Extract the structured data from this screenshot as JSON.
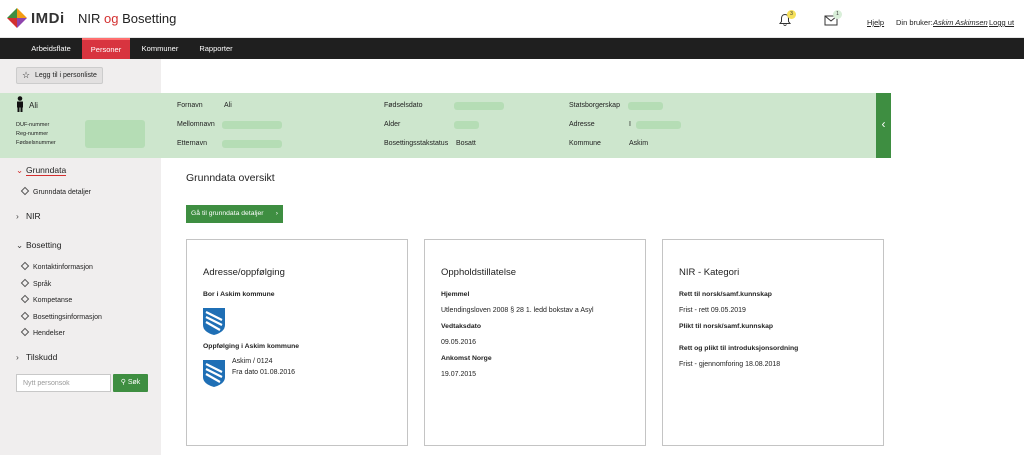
{
  "header": {
    "logo_text": "IMDi",
    "title_part1": "NIR",
    "title_og": "og",
    "title_part2": "Bosetting",
    "notifications_count": "3",
    "messages_count": "1",
    "help_label": "Hjelp",
    "user_prefix": "Din bruker:",
    "user_name": "Askim Askimsen",
    "logout_label": "Logg ut"
  },
  "nav": {
    "items": [
      {
        "label": "Arbeidsflate",
        "active": false
      },
      {
        "label": "Personer",
        "active": true
      },
      {
        "label": "Kommuner",
        "active": false
      },
      {
        "label": "Rapporter",
        "active": false
      }
    ]
  },
  "sidebar": {
    "personliste_button": "Legg til i personliste",
    "sections": [
      {
        "label": "Grunndata",
        "open": true,
        "items": [
          "Grunndata detaljer"
        ]
      },
      {
        "label": "NIR",
        "open": false,
        "items": []
      },
      {
        "label": "Bosetting",
        "open": true,
        "items": [
          "Kontaktinformasjon",
          "Språk",
          "Kompetanse",
          "Bosettingsinformasjon",
          "Hendelser"
        ]
      },
      {
        "label": "Tilskudd",
        "open": false,
        "items": []
      }
    ],
    "search_placeholder": "Nytt personsok",
    "search_button": "Søk"
  },
  "person": {
    "name": "Ali",
    "duf_label": "DUF-nummer",
    "reg_label": "Reg-nummer",
    "fodsel_label": "Fødselsnummer",
    "fornavn_label": "Fornavn",
    "fornavn_value": "Ali",
    "mellomnavn_label": "Mellomnavn",
    "etternavn_label": "Etternavn",
    "fodselsdato_label": "Fødselsdato",
    "alder_label": "Alder",
    "bosettingsstatus_label": "Bosettingsstakstatus",
    "bosettingsstatus_value": "Bosatt",
    "statsborgerskap_label": "Statsborgerskap",
    "adresse_label": "Adresse",
    "adresse_value": "I",
    "kommune_label": "Kommune",
    "kommune_value": "Askim"
  },
  "main": {
    "title": "Grunndata oversikt",
    "go_button": "Gå til grunndata detaljer",
    "go_arrow": "›",
    "cards": {
      "adresse": {
        "title": "Adresse/oppfølging",
        "bor_label": "Bor i Askim kommune",
        "oppfolging_label": "Oppfølging i Askim kommune",
        "kommune_nr": "Askim / 0124",
        "fra_dato": "Fra dato 01.08.2016"
      },
      "opphold": {
        "title": "Oppholdstillatelse",
        "hjemmel_label": "Hjemmel",
        "hjemmel_value": "Utlendingsloven 2008 § 28 1. ledd bokstav a Asyl",
        "vedtak_label": "Vedtaksdato",
        "vedtak_value": "09.05.2016",
        "ankomst_label": "Ankomst Norge",
        "ankomst_value": "19.07.2015"
      },
      "nir": {
        "title": "NIR - Kategori",
        "rett_label": "Rett til norsk/samf.kunnskap",
        "rett_value": "Frist - rett 09.05.2019",
        "plikt_label": "Plikt til norsk/samf.kunnskap",
        "intro_label": "Rett og plikt til introduksjonsordning",
        "intro_value": "Frist - gjennomforing 18.08.2018"
      }
    }
  },
  "colors": {
    "nav_bg": "#1f1f1f",
    "nav_active": "#d8343f",
    "green": "#3e8e41",
    "banner": "#cde6cd",
    "sidebar_bg": "#f0eeee",
    "badge": "#f5e05a"
  }
}
